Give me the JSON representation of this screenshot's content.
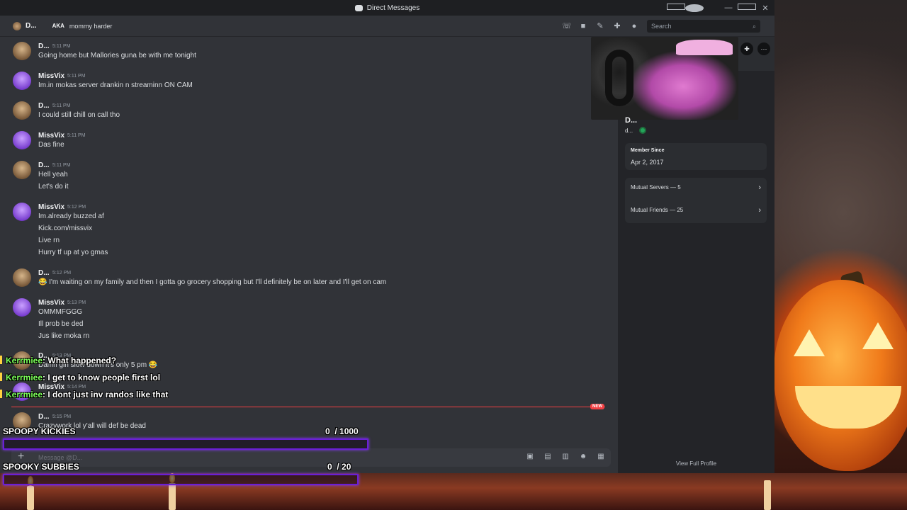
{
  "window": {
    "title": "Direct Messages"
  },
  "header": {
    "name": "D...",
    "aka_label": "AKA",
    "nickname": "mommy harder",
    "search_placeholder": "Search",
    "icons": [
      "phone-icon",
      "video-icon",
      "pin-icon",
      "add-friend-icon",
      "profile-icon",
      "search-icon"
    ]
  },
  "messages": [
    {
      "author": "D...",
      "time": "5:11 PM",
      "avatar": "d",
      "lines": [
        "Going home but Mallories guna be with me tonight"
      ]
    },
    {
      "author": "MissVix",
      "time": "5:11 PM",
      "avatar": "v",
      "lines": [
        "Im.in mokas server drankin n streaminn ON CAM"
      ]
    },
    {
      "author": "D...",
      "time": "5:11 PM",
      "avatar": "d",
      "lines": [
        "I could still chill on call tho"
      ]
    },
    {
      "author": "MissVix",
      "time": "5:11 PM",
      "avatar": "v",
      "lines": [
        "Das fine"
      ]
    },
    {
      "author": "D...",
      "time": "5:11 PM",
      "avatar": "d",
      "lines": [
        "Hell yeah",
        "Let's do it"
      ]
    },
    {
      "author": "MissVix",
      "time": "5:12 PM",
      "avatar": "v",
      "lines": [
        "Im.already buzzed af",
        "Kick.com/missvix",
        "Live rn",
        "Hurry tf up at yo gmas"
      ]
    },
    {
      "author": "D...",
      "time": "5:12 PM",
      "avatar": "d",
      "lines": [
        "😂 I'm waiting on my family and then I gotta go grocery shopping but I'll definitely be on later and I'll get on cam"
      ]
    },
    {
      "author": "MissVix",
      "time": "5:13 PM",
      "avatar": "v",
      "lines": [
        "OMMMFGGG",
        "Ill prob be ded",
        "Jus like moka rn"
      ]
    },
    {
      "author": "D...",
      "time": "5:13 PM",
      "avatar": "d",
      "lines": [
        "Damn girl slow down it's only 5 pm 😂"
      ]
    },
    {
      "author": "MissVix",
      "time": "5:14 PM",
      "avatar": "v",
      "lines": [
        ""
      ]
    },
    {
      "author": "D...",
      "time": "5:15 PM",
      "avatar": "d",
      "lines": [
        "Crazywork lol y'all will def be dead"
      ]
    }
  ],
  "new_badge": "NEW",
  "composer": {
    "placeholder": "Message @D...",
    "icons": [
      "gift-icon",
      "gif-icon",
      "sticker-icon",
      "emoji-icon",
      "apps-icon"
    ]
  },
  "profile": {
    "name": "D...",
    "username": "d...",
    "member_since_label": "Member Since",
    "member_since_value": "Apr 2, 2017",
    "mutual_servers": "Mutual Servers — 5",
    "mutual_friends": "Mutual Friends — 25",
    "view_full": "View Full Profile"
  },
  "overlay": {
    "chat": [
      {
        "user": "Kerrmiee",
        "text": ": What happened?"
      },
      {
        "user": "Kerrmiee",
        "text": ": I get to know people first lol"
      },
      {
        "user": "Kerrmiee",
        "text": ": I dont just inv randos like that"
      }
    ],
    "goals": [
      {
        "title": "SPOOPY KICKIES",
        "current": "0",
        "target": "/ 1000",
        "progress": 0
      },
      {
        "title": "SPOOKY SUBBIES",
        "current": "0",
        "target": "/ 20",
        "progress": 0
      }
    ]
  },
  "colors": {
    "discord_bg": "#313338",
    "panel_bg": "#232428",
    "chat_user": "#7cff5a",
    "goal_bar_border": "#6a1fd6",
    "new_red": "#f23f43"
  }
}
